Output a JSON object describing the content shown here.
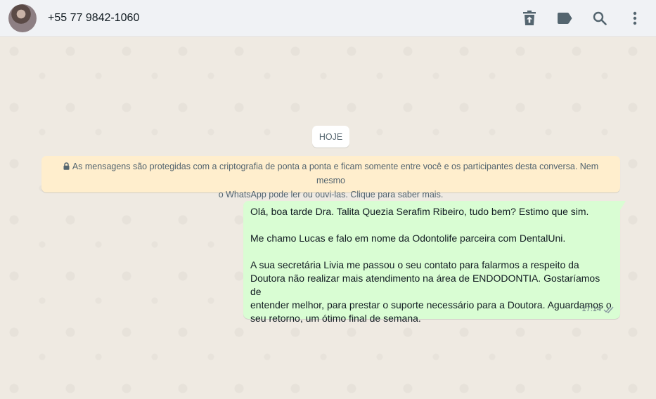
{
  "header": {
    "contact_name": "+55 77 9842-1060",
    "icons": [
      "delete-icon",
      "label-icon",
      "search-icon",
      "more-vertical-icon"
    ]
  },
  "chat": {
    "date_label": "HOJE",
    "encryption_line1": "As mensagens são protegidas com a criptografia de ponta a ponta e ficam somente entre você e os participantes desta conversa. Nem mesmo",
    "encryption_line2": "o WhatsApp pode ler ou ouvi-las. Clique para saber mais.",
    "message": {
      "paragraph1": "Olá, boa tarde Dra. Talita Quezia Serafim Ribeiro, tudo bem? Estimo que sim.",
      "paragraph2": "Me chamo Lucas e falo em nome da Odontolife parceira com DentalUni.",
      "paragraph3_line1": "A sua secretária Livia me passou o seu contato para falarmos a respeito da",
      "paragraph3_line2": "Doutora não realizar mais atendimento na área de ENDODONTIA. Gostaríamos de",
      "paragraph3_line3": "entender melhor, para prestar o suporte necessário para a Doutora. Aguardamos o",
      "paragraph3_line4": "seu retorno, um ótimo final de semana.",
      "time": "17:14",
      "status_icon": "double-check-icon"
    }
  },
  "colors": {
    "header_bg": "#f0f2f5",
    "chat_bg": "#efeae2",
    "outgoing_bubble": "#d9fdd3",
    "encryption_bg": "#ffeecd",
    "icon_color": "#54656f"
  }
}
